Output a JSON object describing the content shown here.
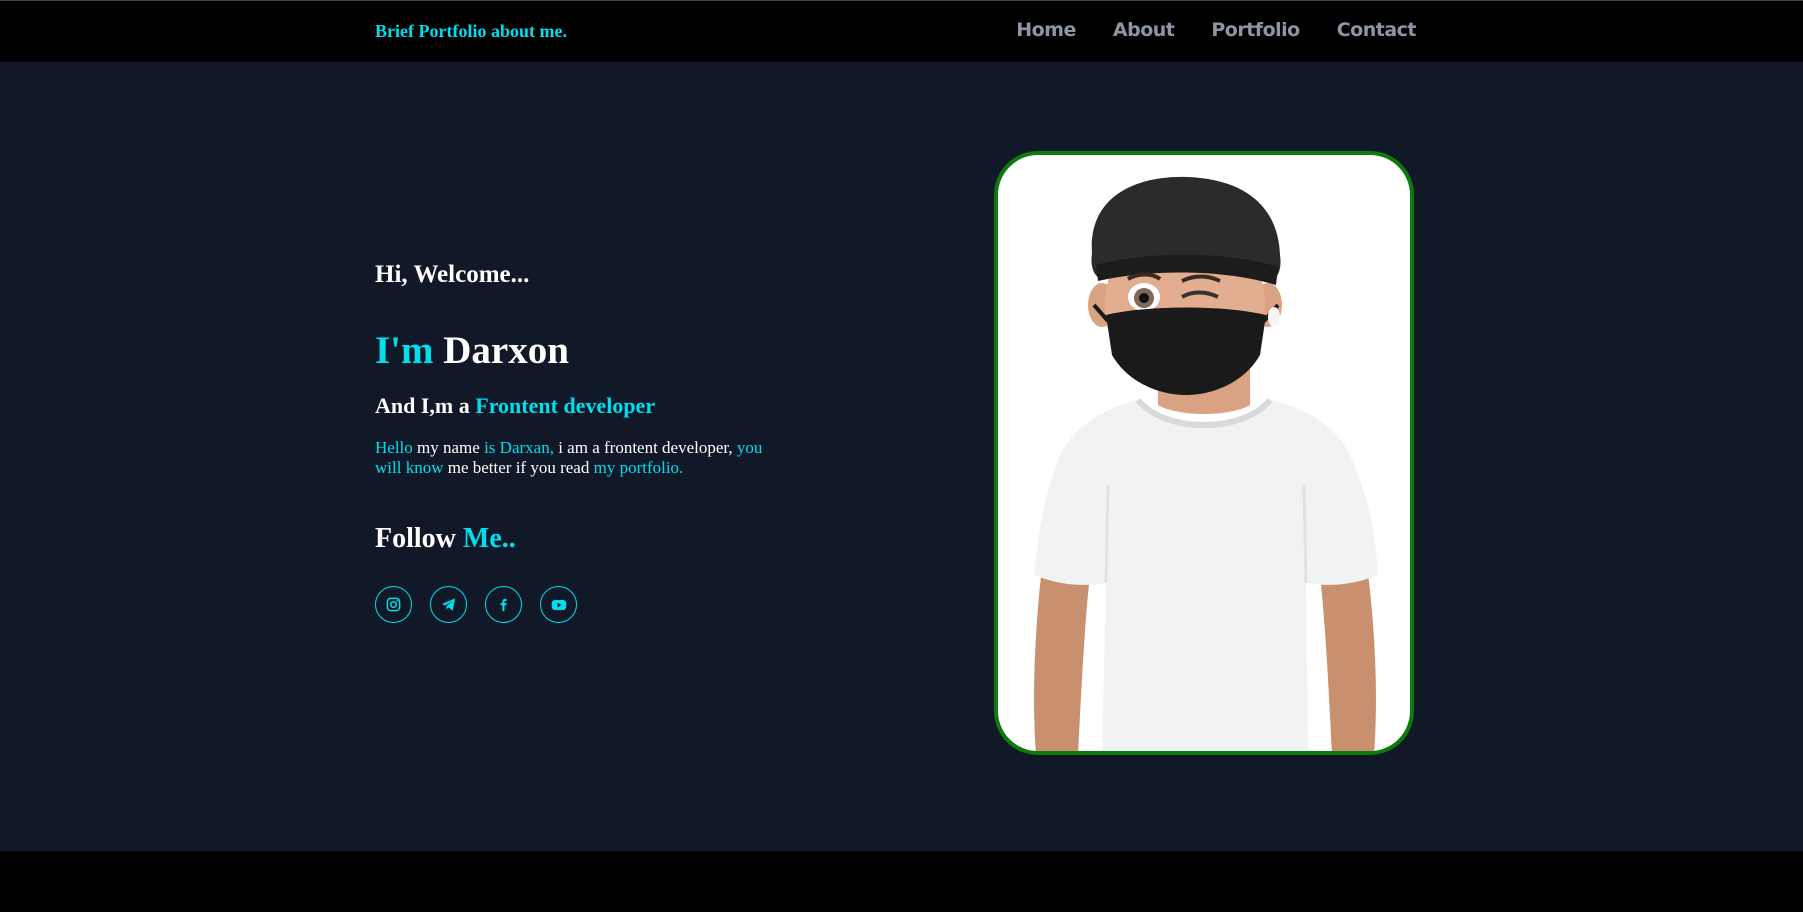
{
  "header": {
    "brand": "Brief Portfolio about me.",
    "nav": [
      "Home",
      "About",
      "Portfolio",
      "Contact"
    ]
  },
  "hero": {
    "welcome": "Hi, Welcome...",
    "name_prefix": "I'm",
    "name": "Darxon",
    "role_prefix": "And I,m a",
    "role": "Frontent developer",
    "bio": {
      "part1": "Hello",
      "part2": " my name ",
      "part3": "is Darxan,",
      "part4": " i am a frontent developer, ",
      "part5": "you will know",
      "part6": " me better if you read ",
      "part7": "my portfolio."
    },
    "follow_prefix": "Follow",
    "follow_accent": "Me..",
    "socials": [
      "instagram-icon",
      "telegram-icon",
      "facebook-icon",
      "youtube-icon"
    ]
  },
  "colors": {
    "accent": "#00dfee",
    "background": "#111827",
    "photo_border": "#0c7a0c",
    "nav_text": "#8f96a3"
  }
}
